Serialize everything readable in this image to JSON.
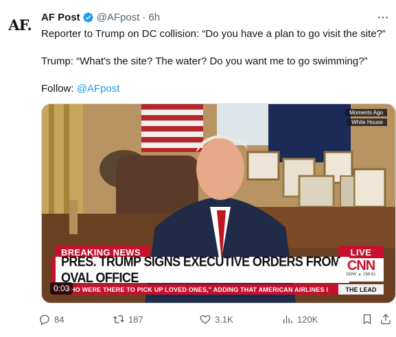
{
  "account": {
    "avatar_text": "AF.",
    "name": "AF Post",
    "handle": "@AFpost",
    "separator": "·",
    "time": "6h"
  },
  "tweet": {
    "line1": "Reporter to Trump on DC collision: “Do you have a plan to go visit the site?”",
    "line2": "Trump: “What's the site? The water? Do you want me to go swimming?”",
    "follow_label": "Follow: ",
    "follow_link": "@AFpost"
  },
  "media": {
    "tag_top": "Moments Ago",
    "tag_bottom": "White House",
    "breaking_label": "BREAKING NEWS",
    "live_label": "LIVE",
    "headline": "PRES. TRUMP SIGNS EXECUTIVE ORDERS FROM OVAL OFFICE",
    "network_logo": "CNN",
    "dow_label": "DOW",
    "dow_arrow": "▲",
    "dow_value": "168.61",
    "ticker": "\"... WHO WERE THERE TO PICK UP LOVED ONES,\" ADDING THAT AMERICAN AIRLINES I",
    "show_name": "THE LEAD",
    "timer": "0:03"
  },
  "actions": {
    "replies": "84",
    "reposts": "187",
    "likes": "3.1K",
    "views": "120K"
  },
  "colors": {
    "accent": "#1d9bf0",
    "breaking_red": "#c8102e",
    "muted": "#536471"
  },
  "icons": [
    "verified-badge-icon",
    "more-icon",
    "reply-icon",
    "repost-icon",
    "like-icon",
    "views-icon",
    "bookmark-icon",
    "share-icon"
  ]
}
